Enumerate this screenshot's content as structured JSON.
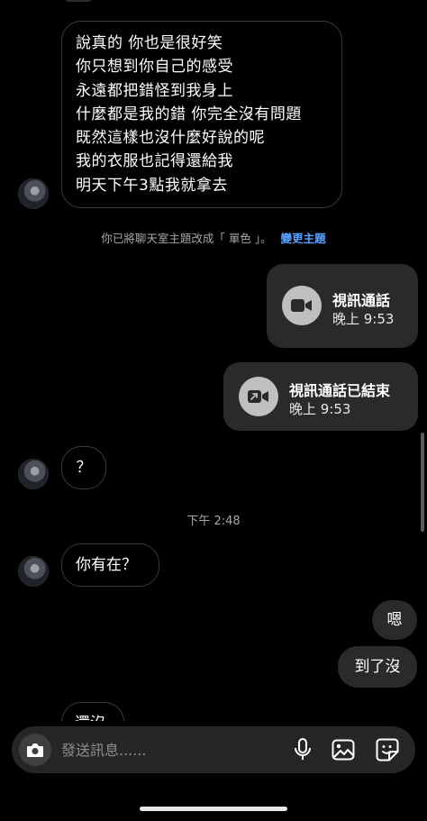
{
  "messages": {
    "long_text": "說真的 你也是很好笑\n你只想到你自己的感受\n永遠都把錯怪到我身上\n什麼都是我的錯 你完全沒有問題\n既然這樣也沒什麼好說的呢\n我的衣服也記得還給我\n明天下午3點我就拿去",
    "question": "？",
    "are_you_there": "你有在？",
    "mm": "嗯",
    "arrived": "到了沒",
    "not_yet": "還沒"
  },
  "system_note": {
    "text": "你已將聊天室主題改成「 單色 」。",
    "link": "變更主題"
  },
  "calls": [
    {
      "title": "視訊通話",
      "time": "晚上 9:53",
      "icon": "video-camera-icon"
    },
    {
      "title": "視訊通話已結束",
      "time": "晚上 9:53",
      "icon": "call-ended-icon"
    }
  ],
  "timestamp": "下午 2:48",
  "composer": {
    "placeholder": "發送訊息......",
    "icons": [
      "camera-icon",
      "microphone-icon",
      "image-icon",
      "sticker-icon"
    ]
  },
  "colors": {
    "background": "#000000",
    "outgoing_bubble": "#2a2a2c",
    "link": "#5aa2ff"
  }
}
